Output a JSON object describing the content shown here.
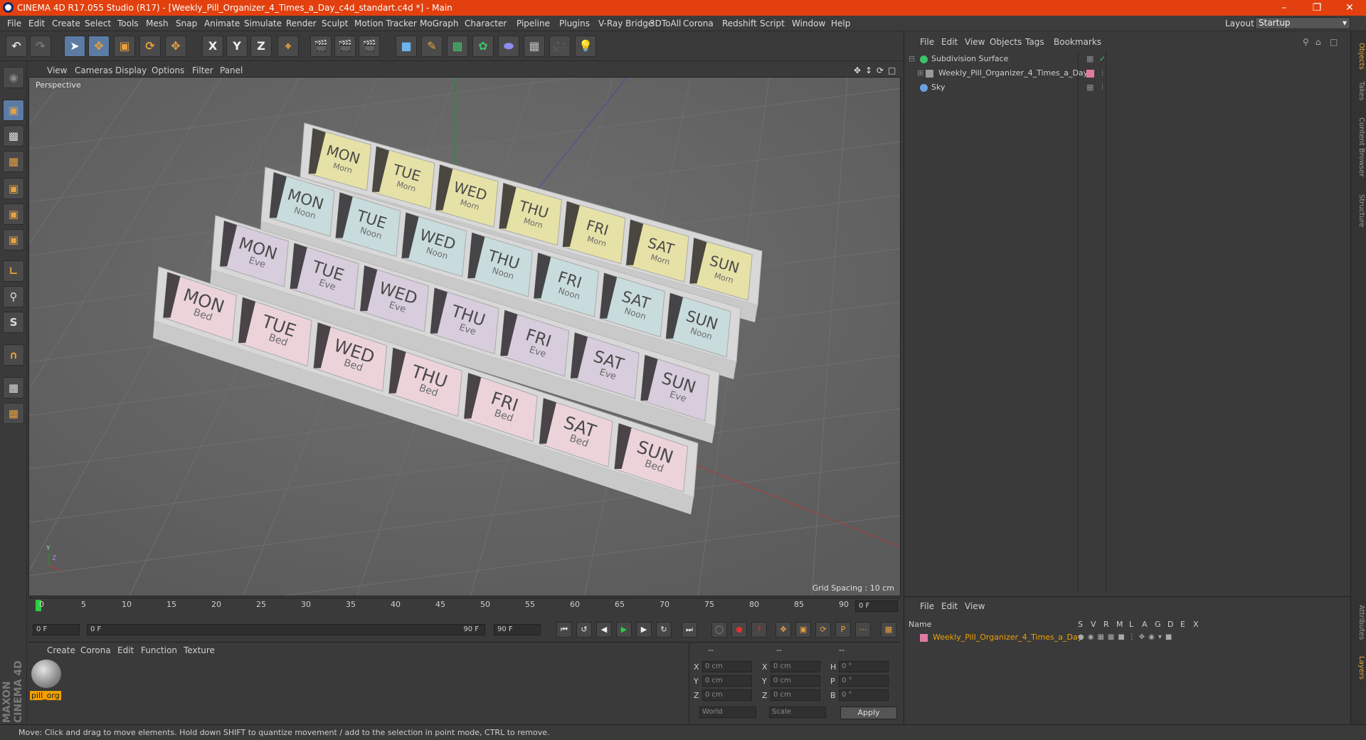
{
  "window": {
    "title": "CINEMA 4D R17.055 Studio (R17) - [Weekly_Pill_Organizer_4_Times_a_Day_c4d_standart.c4d *] - Main",
    "minimize": "–",
    "restore": "❐",
    "close": "✕"
  },
  "menubar": {
    "items": [
      "File",
      "Edit",
      "Create",
      "Select",
      "Tools",
      "Mesh",
      "Snap",
      "Animate",
      "Simulate",
      "Render",
      "Sculpt",
      "Motion Tracker",
      "MoGraph",
      "Character",
      "Pipeline",
      "Plugins",
      "V-Ray Bridge",
      "3DToAll",
      "Corona",
      "Redshift",
      "Script",
      "Window",
      "Help"
    ],
    "layout_label": "Layout:",
    "layout_value": "Startup"
  },
  "toolbar": {
    "axis_x": "X",
    "axis_y": "Y",
    "axis_z": "Z"
  },
  "viewport": {
    "menu": [
      "View",
      "Cameras",
      "Display",
      "Options",
      "Filter",
      "Panel"
    ],
    "label": "Perspective",
    "grid_spacing": "Grid Spacing : 10 cm",
    "axis_y": "Y",
    "axis_z": "Z"
  },
  "organizer": {
    "days": [
      "MON",
      "TUE",
      "WED",
      "THU",
      "FRI",
      "SAT",
      "SUN"
    ],
    "rows": [
      {
        "time": "Morn",
        "color": "#e6e1a6"
      },
      {
        "time": "Noon",
        "color": "#c9dcdd"
      },
      {
        "time": "Eve",
        "color": "#d8cddc"
      },
      {
        "time": "Bed",
        "color": "#ecd3da"
      }
    ]
  },
  "timeline": {
    "ticks": [
      "0",
      "5",
      "10",
      "15",
      "20",
      "25",
      "30",
      "35",
      "40",
      "45",
      "50",
      "55",
      "60",
      "65",
      "70",
      "75",
      "80",
      "85",
      "90"
    ],
    "current_frame": "0 F",
    "start_field": "0 F",
    "range_start": "0 F",
    "range_end": "90 F",
    "end_field": "90 F"
  },
  "materials": {
    "menu": [
      "Create",
      "Corona",
      "Edit",
      "Function",
      "Texture"
    ],
    "items": [
      {
        "name": "pill_org"
      }
    ]
  },
  "coordinates": {
    "header": [
      "--",
      "--",
      "--"
    ],
    "rows": [
      {
        "l1": "X",
        "v1": "0 cm",
        "l2": "X",
        "v2": "0 cm",
        "l3": "H",
        "v3": "0 °"
      },
      {
        "l1": "Y",
        "v1": "0 cm",
        "l2": "Y",
        "v2": "0 cm",
        "l3": "P",
        "v3": "0 °"
      },
      {
        "l1": "Z",
        "v1": "0 cm",
        "l2": "Z",
        "v2": "0 cm",
        "l3": "B",
        "v3": "0 °"
      }
    ],
    "mode": "World",
    "transform": "Scale",
    "apply": "Apply"
  },
  "objects": {
    "menu": [
      "File",
      "Edit",
      "View",
      "Objects",
      "Tags",
      "Bookmarks"
    ],
    "items": [
      {
        "name": "Subdivision Surface",
        "icon_color": "#3cc36a"
      },
      {
        "name": "Weekly_Pill_Organizer_4_Times_a_Day",
        "icon_color": "#9a9a9a"
      },
      {
        "name": "Sky",
        "icon_color": "#6aa0e0"
      }
    ]
  },
  "layers": {
    "menu": [
      "File",
      "Edit",
      "View"
    ],
    "col_name": "Name",
    "cols": [
      "S",
      "V",
      "R",
      "M",
      "L",
      "A",
      "G",
      "D",
      "E",
      "X"
    ],
    "items": [
      {
        "name": "Weekly_Pill_Organizer_4_Times_a_Day",
        "color": "#e07aa0"
      }
    ]
  },
  "side_tabs": [
    "Objects",
    "Takes",
    "Content Browser",
    "Structure",
    "Attributes",
    "Layers"
  ],
  "status": "Move: Click and drag to move elements. Hold down SHIFT to quantize movement / add to the selection in point mode, CTRL to remove.",
  "brand": "MAXON CINEMA 4D"
}
